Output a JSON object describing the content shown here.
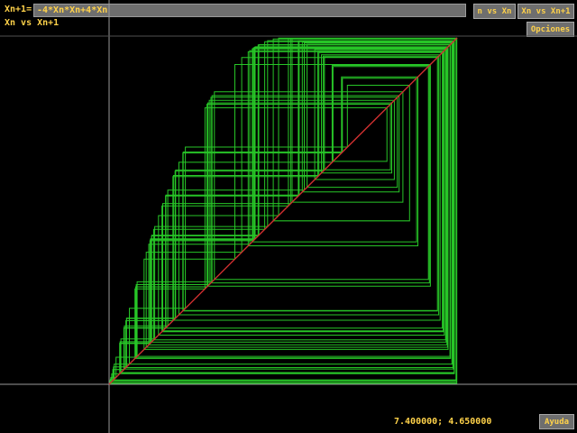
{
  "toolbar": {
    "formula_label": "Xn+1=",
    "formula_value": "-4*Xn*Xn+4*Xn",
    "mode_label": "Xn vs Xn+1",
    "n_vs_xn_label": "n vs Xn",
    "xn_vs_xn1_label": "Xn vs Xn+1",
    "options_label": "Opciones"
  },
  "footer": {
    "coords": "7.400000; 4.650000",
    "help_label": "Ayuda"
  },
  "colors": {
    "background": "#000000",
    "axis": "#9a9a9a",
    "diagonal": "#d03030",
    "cobweb": "#2ee82e",
    "text": "#ffd24a",
    "button_face": "#6e6e6e"
  },
  "chart_data": {
    "type": "cobweb",
    "map": "x_{n+1} = -4*x_n*x_n + 4*x_n",
    "x0": 0.005,
    "iterations": 140,
    "xlim": [
      0,
      1
    ],
    "ylim": [
      0,
      1
    ],
    "diagonal": true
  }
}
